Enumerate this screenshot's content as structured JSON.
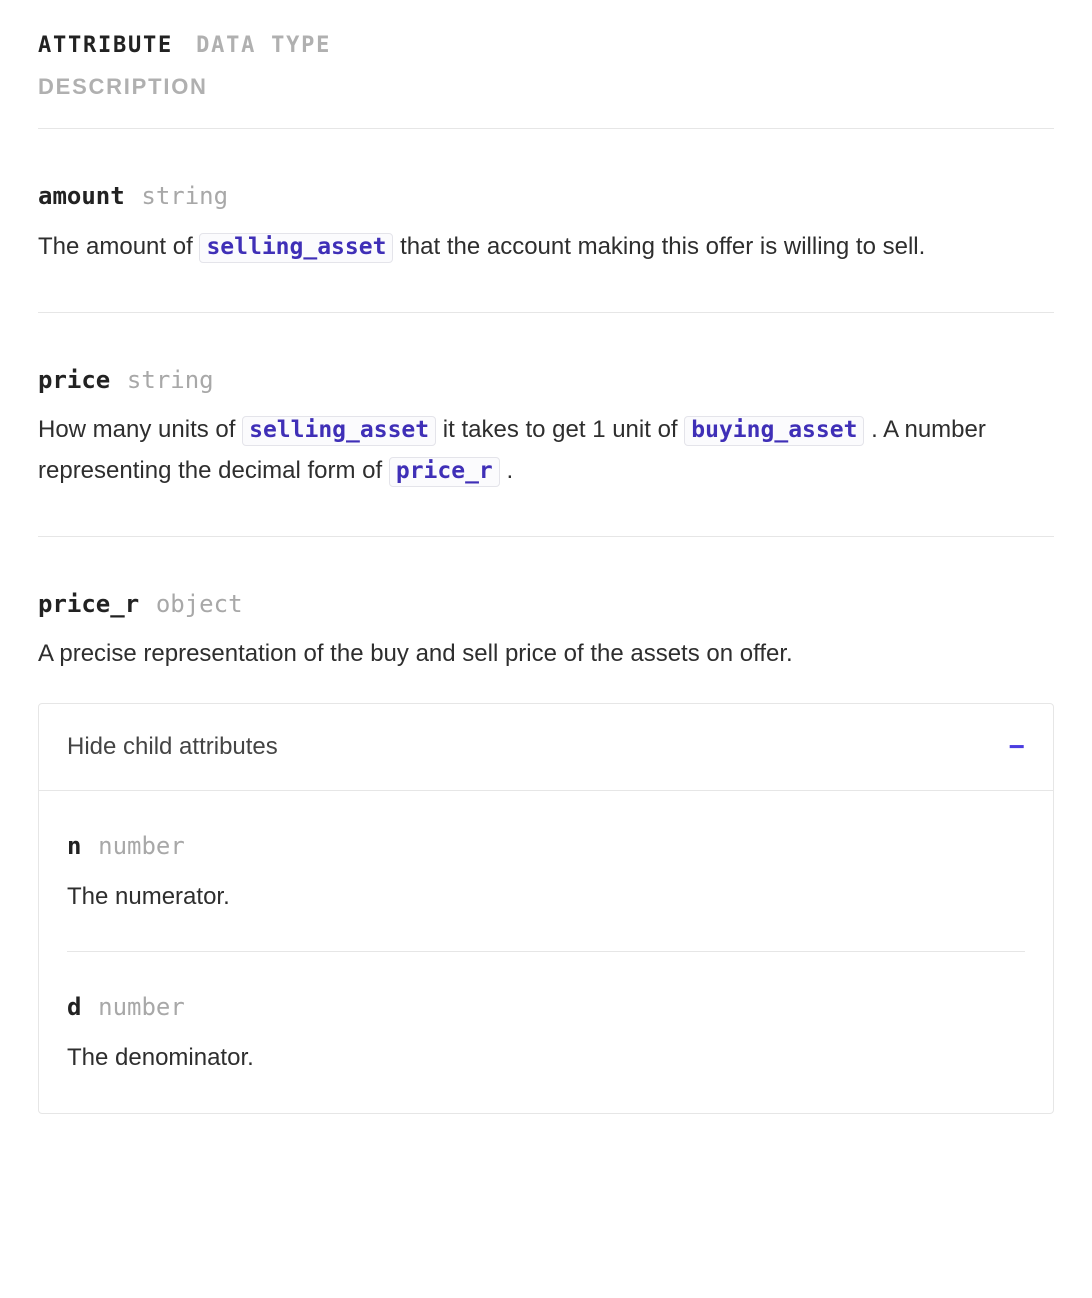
{
  "headers": {
    "attribute": "ATTRIBUTE",
    "dataType": "DATA TYPE",
    "description": "DESCRIPTION"
  },
  "codes": {
    "selling_asset": "selling_asset",
    "buying_asset": "buying_asset",
    "price_r": "price_r"
  },
  "attributes": [
    {
      "name": "amount",
      "type": "string",
      "desc_parts": [
        "The amount of ",
        " that the account making this offer is willing to sell."
      ]
    },
    {
      "name": "price",
      "type": "string",
      "desc_parts_a": [
        "How many units of ",
        " it takes to get 1 unit of ",
        " . A number representing the decimal form of ",
        "."
      ]
    },
    {
      "name": "price_r",
      "type": "object",
      "desc": "A precise representation of the buy and sell price of the assets on offer."
    }
  ],
  "childToggle": {
    "label": "Hide child attributes",
    "icon": "−"
  },
  "childAttributes": [
    {
      "name": "n",
      "type": "number",
      "desc": "The numerator."
    },
    {
      "name": "d",
      "type": "number",
      "desc": "The denominator."
    }
  ]
}
